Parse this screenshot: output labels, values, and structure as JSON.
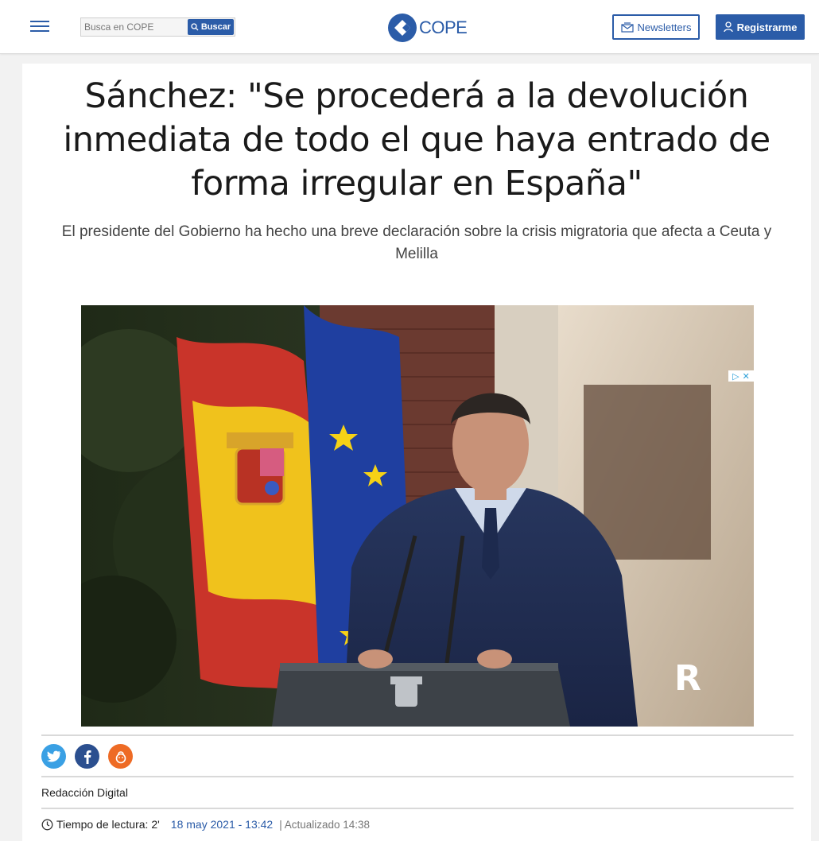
{
  "header": {
    "search_placeholder": "Busca en COPE",
    "search_button": "Buscar",
    "logo_text": "COPE",
    "newsletters_button": "Newsletters",
    "register_button": "Registrarme"
  },
  "article": {
    "headline": "Sánchez: \"Se procederá a la devolución inmediata de todo el que haya entrado de forma irregular en España\"",
    "subtitle": "El presidente del Gobierno ha hecho una breve declaración sobre la crisis migratoria que afecta a Ceuta y Melilla",
    "photo_watermark": "R",
    "author": "Redacción Digital",
    "reading_time": "Tiempo de lectura: 2'",
    "date": "18 may 2021 - 13:42",
    "updated": "| Actualizado 14:38"
  },
  "share": [
    {
      "name": "twitter",
      "color": "#3aa0e4"
    },
    {
      "name": "facebook",
      "color": "#2b4f8f"
    },
    {
      "name": "meneame",
      "color": "#ee6b25"
    }
  ],
  "colors": {
    "brand": "#2b5ca8"
  }
}
